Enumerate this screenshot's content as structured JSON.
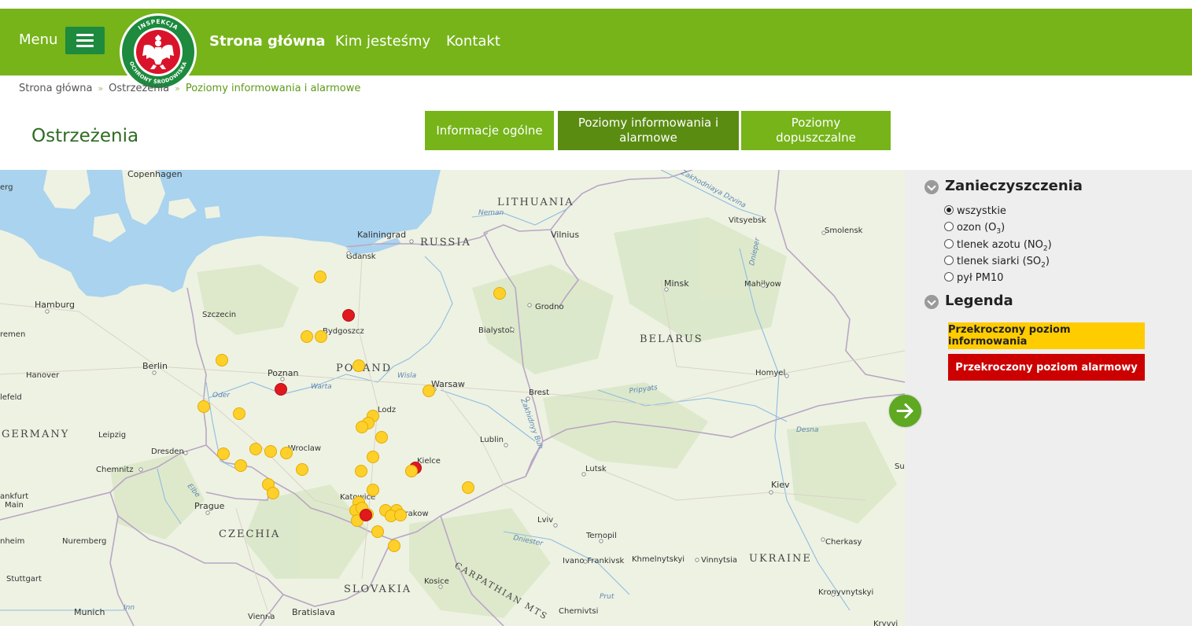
{
  "header": {
    "menu_label": "Menu",
    "logo_ring_top": "INSPEKCJA",
    "logo_ring_bottom": "OCHRONY ŚRODOWISKA",
    "nav": [
      {
        "label": "Strona główna"
      },
      {
        "label": "Kim jesteśmy"
      },
      {
        "label": "Kontakt"
      }
    ]
  },
  "breadcrumb": {
    "items": [
      "Strona główna",
      "Ostrzeżenia",
      "Poziomy informowania i alarmowe"
    ],
    "separator": "»"
  },
  "page_title": "Ostrzeżenia",
  "tabs": [
    {
      "label": "Informacje ogólne",
      "active": false
    },
    {
      "label": "Poziomy informowania i alarmowe",
      "active": true
    },
    {
      "label": "Poziomy dopuszczalne",
      "active": false
    }
  ],
  "sidebar": {
    "pollutants_heading": "Zanieczyszczenia",
    "pollutants": [
      {
        "label": "wszystkie",
        "sub": "",
        "suffix": "",
        "selected": true
      },
      {
        "label": "ozon (O",
        "sub": "3",
        "suffix": ")",
        "selected": false
      },
      {
        "label": "tlenek azotu (NO",
        "sub": "2",
        "suffix": ")",
        "selected": false
      },
      {
        "label": "tlenek siarki (SO",
        "sub": "2",
        "suffix": ")",
        "selected": false
      },
      {
        "label": "pył PM10",
        "sub": "",
        "suffix": "",
        "selected": false
      }
    ],
    "legend_heading": "Legenda",
    "legend": [
      {
        "label": "Przekroczony poziom informowania",
        "color": "#ffcc00",
        "text_color": "#222222"
      },
      {
        "label": "Przekroczony poziom alarmowy",
        "color": "#cc0000",
        "text_color": "#ffffff"
      }
    ]
  },
  "map": {
    "country_labels": [
      "LITHUANIA",
      "RUSSIA",
      "POLAND",
      "BELARUS",
      "GERMANY",
      "CZECHIA",
      "SLOVAKIA",
      "UKRAINE",
      "CARPATHIAN MTS"
    ],
    "city_labels": [
      "Copenhagen",
      "Kaliningrad",
      "Vilnius",
      "Vitsyebsk",
      "Smolensk",
      "Gdansk",
      "Minsk",
      "Mahilyow",
      "Hamburg",
      "Szczecin",
      "Bydgoszcz",
      "Grodno",
      "Bialystok",
      "Hanover",
      "Berlin",
      "Poznan",
      "Warsaw",
      "Homyel",
      "Brest",
      "Lodz",
      "Leipzig",
      "Dresden",
      "Wroclaw",
      "Lublin",
      "Chemnitz",
      "Kielce",
      "Lutsk",
      "Kiev",
      "Prague",
      "Katowice",
      "Krakow",
      "Lviv",
      "Ternopil",
      "Nuremberg",
      "Cherkasy",
      "Ivano-Frankivsk",
      "Khmelnytskyi",
      "Vinnytsia",
      "Kosice",
      "Kropyvnytskyi",
      "Stuttgart",
      "Munich",
      "Vienna",
      "Bratislava",
      "Chernivtsi",
      "erg",
      "remen",
      "lefeld",
      "ankfurt",
      "Main",
      "nheim",
      "Su",
      "Kryvyi"
    ],
    "water_labels": [
      "Neman",
      "Warta",
      "Oder",
      "Wisla",
      "Pripyats",
      "Desna",
      "Dniester",
      "Prut",
      "Elbe",
      "Inn",
      "Dnieper",
      "Zakhodniaya Dzvina",
      "Zakhidnyy Buh"
    ],
    "stations_info_level": 37,
    "stations_alarm_level": 5
  }
}
